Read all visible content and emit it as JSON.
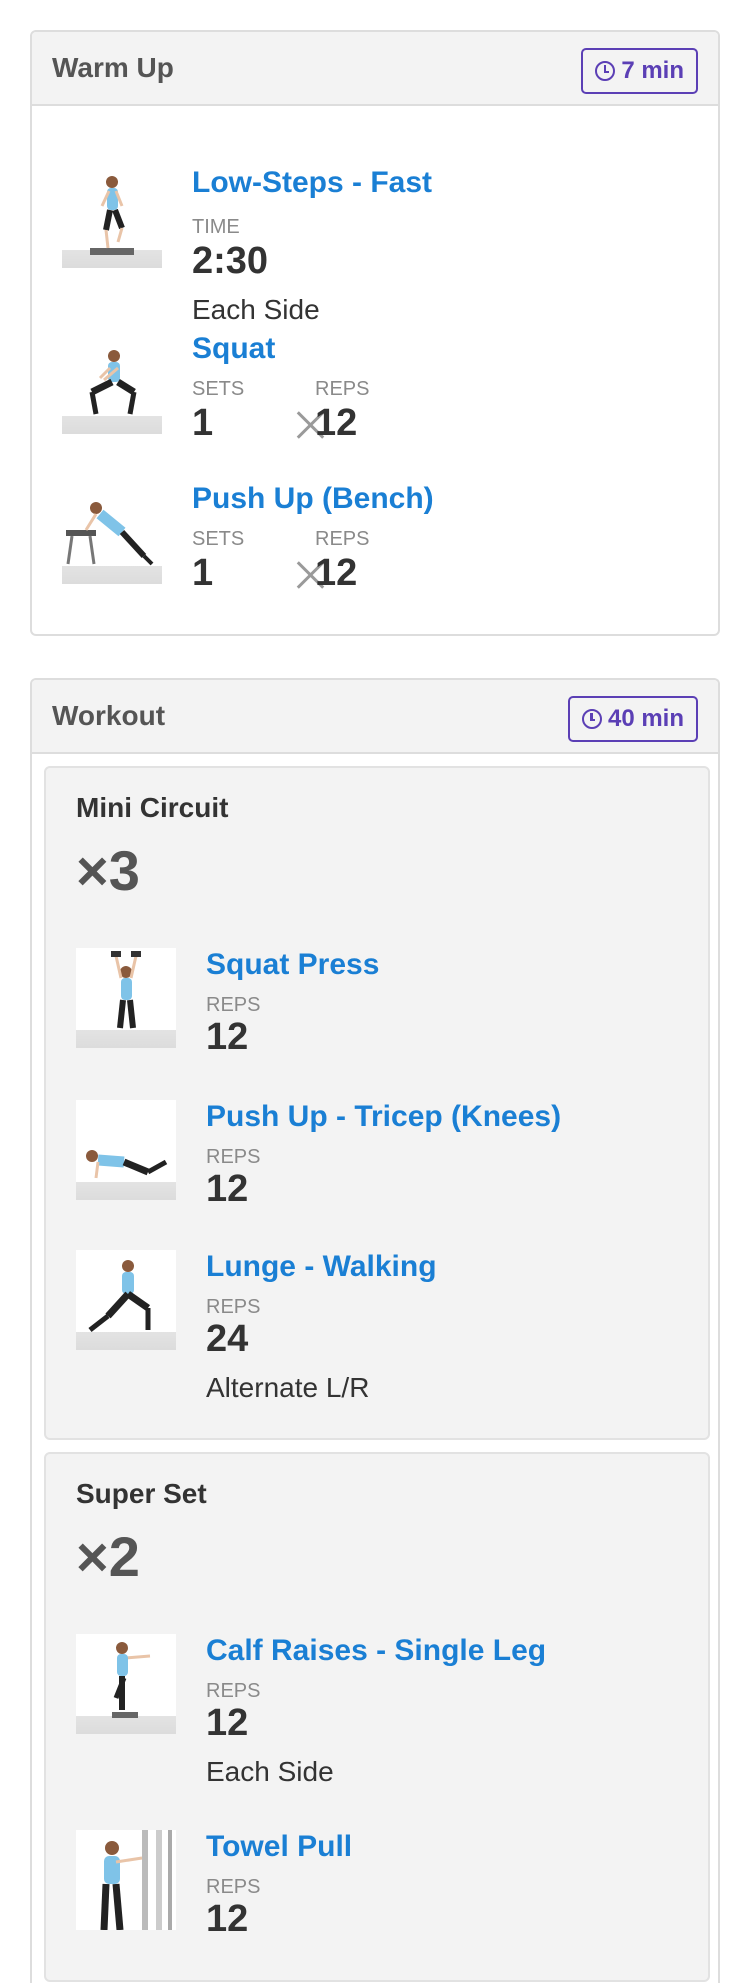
{
  "warmup": {
    "title": "Warm Up",
    "duration": "7 min",
    "exercises": [
      {
        "name": "Low-Steps - Fast",
        "time_label": "TIME",
        "time_value": "2:30",
        "note": "Each Side"
      },
      {
        "name": "Squat",
        "sets_label": "SETS",
        "sets_value": "1",
        "reps_label": "REPS",
        "reps_value": "12"
      },
      {
        "name": "Push Up (Bench)",
        "sets_label": "SETS",
        "sets_value": "1",
        "reps_label": "REPS",
        "reps_value": "12"
      }
    ]
  },
  "workout": {
    "title": "Workout",
    "duration": "40 min",
    "circuits": [
      {
        "title": "Mini Circuit",
        "multiplier": "×3",
        "exercises": [
          {
            "name": "Squat Press",
            "reps_label": "REPS",
            "reps_value": "12"
          },
          {
            "name": "Push Up - Tricep (Knees)",
            "reps_label": "REPS",
            "reps_value": "12"
          },
          {
            "name": "Lunge - Walking",
            "reps_label": "REPS",
            "reps_value": "24",
            "note": "Alternate L/R"
          }
        ]
      },
      {
        "title": "Super Set",
        "multiplier": "×2",
        "exercises": [
          {
            "name": "Calf Raises - Single Leg",
            "reps_label": "REPS",
            "reps_value": "12",
            "note": "Each Side"
          },
          {
            "name": "Towel Pull",
            "reps_label": "REPS",
            "reps_value": "12"
          }
        ]
      }
    ]
  },
  "colors": {
    "link": "#1a7fd4",
    "badge": "#5b3fb5",
    "shirt": "#7fc3e8",
    "pants": "#222222"
  }
}
